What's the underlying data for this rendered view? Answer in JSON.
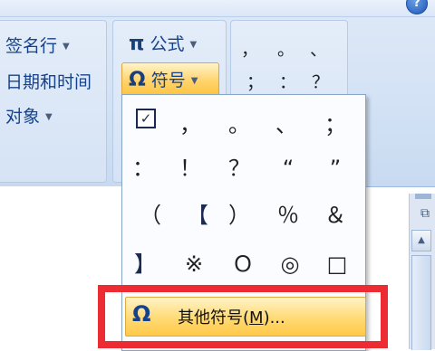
{
  "ribbon": {
    "group_left": {
      "signature_line": "签名行",
      "date_time": "日期和时间",
      "object": "对象"
    },
    "group_symbols": {
      "equation": "公式",
      "equation_glyph": "π",
      "symbol": "符号",
      "symbol_glyph": "Ω"
    },
    "quick_symbols": [
      "，",
      "。",
      "、",
      "；",
      "：",
      "？"
    ]
  },
  "symbol_popup": {
    "grid": [
      [
        "☑",
        "，",
        "。",
        "、",
        "；"
      ],
      [
        "：",
        "！",
        "？",
        "“",
        "”"
      ],
      [
        "（",
        "【",
        "）",
        "％",
        "＆"
      ],
      [
        "】",
        "※",
        "Ｏ",
        "◎",
        "□"
      ]
    ],
    "more_symbols": {
      "glyph": "Ω",
      "label_prefix": "其他符号(",
      "hotkey": "M",
      "label_suffix": ")..."
    }
  },
  "colors": {
    "highlight": "#ffd36b",
    "annotation_box": "#ed2b32",
    "ribbon_text": "#15428b"
  }
}
